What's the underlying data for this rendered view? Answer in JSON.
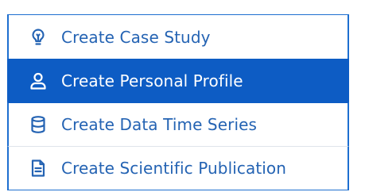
{
  "menu": {
    "items": [
      {
        "label": "Create Case Study",
        "icon": "lightbulb-icon",
        "active": false
      },
      {
        "label": "Create Personal Profile",
        "icon": "user-icon",
        "active": true
      },
      {
        "label": "Create Data Time Series",
        "icon": "database-icon",
        "active": false
      },
      {
        "label": "Create Scientific Publication",
        "icon": "document-icon",
        "active": false
      }
    ]
  },
  "colors": {
    "text": "#2463b3",
    "active_background": "#0d5cc4",
    "active_text": "#ffffff",
    "border": "#1e6fd0"
  }
}
